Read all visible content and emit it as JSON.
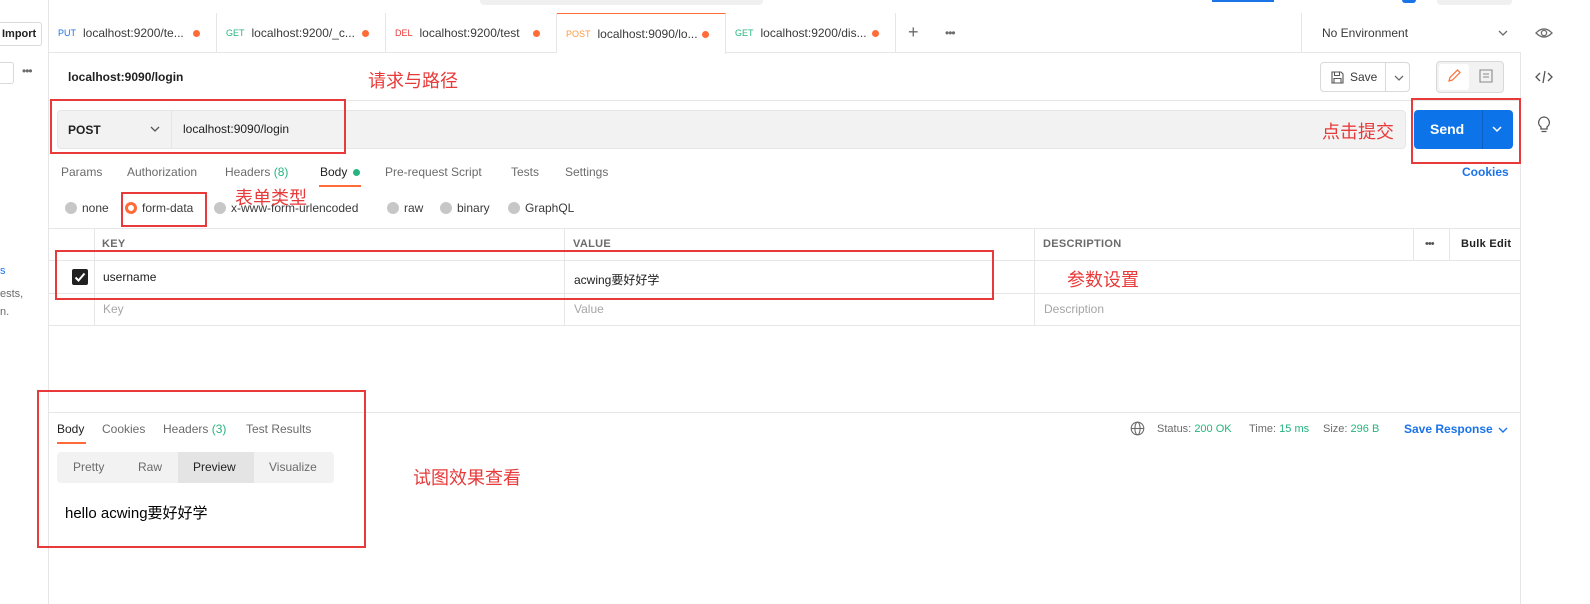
{
  "sidebar": {
    "import_label": "Import",
    "text1": "s",
    "text2": "ests,",
    "text3": "n."
  },
  "tabs": [
    {
      "method": "PUT",
      "url": "localhost:9200/te...",
      "method_color": "#1b73e8"
    },
    {
      "method": "GET",
      "url": "localhost:9200/_c...",
      "method_color": "#26b47f"
    },
    {
      "method": "DEL",
      "url": "localhost:9200/test",
      "method_color": "#e83a3a"
    },
    {
      "method": "POST",
      "url": "localhost:9090/lo...",
      "method_color": "#ff9a3d"
    },
    {
      "method": "GET",
      "url": "localhost:9200/dis...",
      "method_color": "#26b47f"
    }
  ],
  "environment": "No Environment",
  "request": {
    "title": "localhost:9090/login",
    "save_label": "Save",
    "method": "POST",
    "url": "localhost:9090/login",
    "send_label": "Send"
  },
  "request_tabs": {
    "params": "Params",
    "authorization": "Authorization",
    "headers": "Headers",
    "headers_count": "(8)",
    "body": "Body",
    "prerequest": "Pre-request Script",
    "tests": "Tests",
    "settings": "Settings",
    "cookies": "Cookies"
  },
  "body_types": {
    "none": "none",
    "form_data": "form-data",
    "urlencoded": "x-www-form-urlencoded",
    "raw": "raw",
    "binary": "binary",
    "graphql": "GraphQL"
  },
  "table": {
    "key_header": "KEY",
    "value_header": "VALUE",
    "description_header": "DESCRIPTION",
    "bulk_edit": "Bulk Edit",
    "row": {
      "key": "username",
      "value": "acwing要好好学"
    },
    "placeholder": {
      "key": "Key",
      "value": "Value",
      "description": "Description"
    }
  },
  "response": {
    "tabs": {
      "body": "Body",
      "cookies": "Cookies",
      "headers": "Headers",
      "headers_count": "(3)",
      "test_results": "Test Results"
    },
    "status_label": "Status:",
    "status_value": "200 OK",
    "time_label": "Time:",
    "time_value": "15 ms",
    "size_label": "Size:",
    "size_value": "296 B",
    "save_response": "Save Response",
    "view_options": {
      "pretty": "Pretty",
      "raw": "Raw",
      "preview": "Preview",
      "visualize": "Visualize"
    },
    "preview_text": "hello acwing要好好学"
  },
  "annotations": {
    "path": "请求与路径",
    "submit": "点击提交",
    "form_type": "表单类型",
    "params": "参数设置",
    "view": "试图效果查看"
  },
  "colors": {
    "accent": "#ff6c37",
    "primary": "#0c74e8",
    "annotation": "#e83a3a",
    "success": "#26b47f"
  }
}
